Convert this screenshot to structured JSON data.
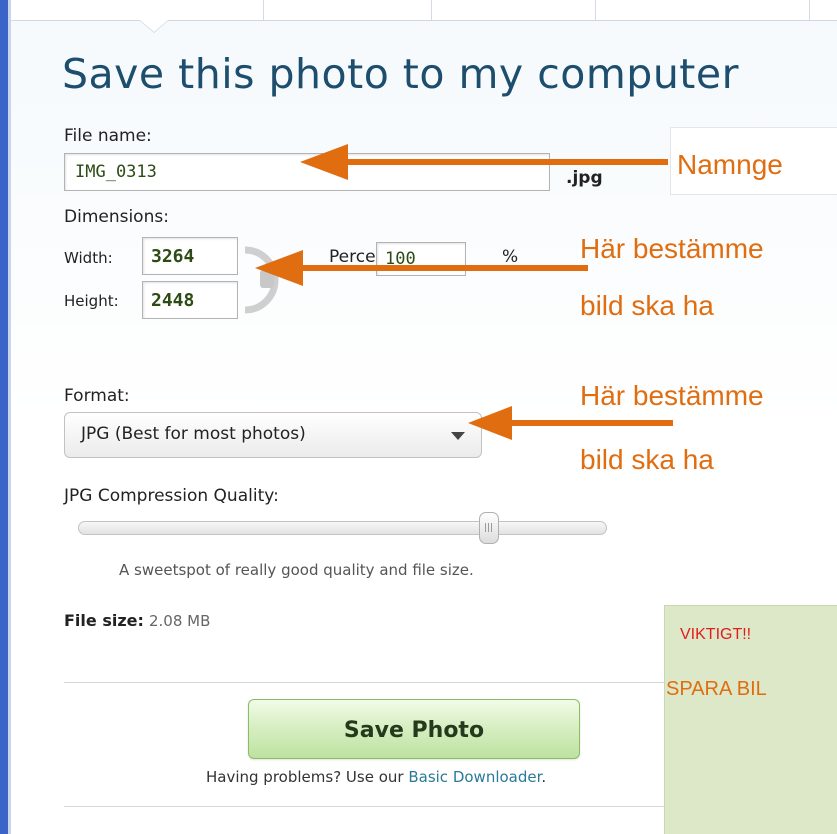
{
  "title": "Save this photo to my computer",
  "file_name": {
    "label": "File name:",
    "value": "IMG_0313",
    "extension": ".jpg"
  },
  "dimensions": {
    "label": "Dimensions:",
    "width_label": "Width:",
    "width_value": "3264",
    "height_label": "Height:",
    "height_value": "2448",
    "percent_label": "Percent:",
    "percent_value": "100",
    "percent_unit": "%"
  },
  "format": {
    "label": "Format:",
    "selected": "JPG  (Best for most photos)"
  },
  "quality": {
    "label": "JPG Compression Quality:",
    "level_fraction": 0.8,
    "note": "A sweetspot of really good quality and file size."
  },
  "file_size": {
    "label": "File size:",
    "value": "2.08 MB"
  },
  "save_button": "Save Photo",
  "help": {
    "prefix": "Having problems? Use our ",
    "link": "Basic Downloader",
    "suffix": "."
  },
  "annotations": {
    "callout_1": "Namnge",
    "callout_2_line1": "Här bestämme",
    "callout_2_line2": "bild ska ha",
    "callout_3_line1": "Här bestämme",
    "callout_3_line2": "bild ska ha",
    "important_title": "VIKTIGT!!",
    "important_text": "SPARA BIL"
  },
  "colors": {
    "title": "#1d4e6e",
    "annotation": "#e06d10",
    "important": "#e21c1c",
    "save_button": "#c8e8ad"
  }
}
